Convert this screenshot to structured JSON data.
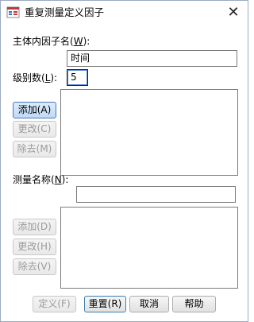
{
  "window": {
    "title": "重复测量定义因子",
    "close_glyph": "✕"
  },
  "factor": {
    "name_label_pre": "主体内因子名(",
    "name_label_key": "W",
    "name_label_post": "):",
    "name_value": "时间",
    "levels_label_pre": "级别数(",
    "levels_label_key": "L",
    "levels_label_post": "):",
    "levels_value": "5",
    "add_label": "添加(A)",
    "change_label": "更改(C)",
    "remove_label": "除去(M)"
  },
  "measure": {
    "name_label_pre": "测量名称(",
    "name_label_key": "N",
    "name_label_post": "):",
    "name_value": "",
    "add_label": "添加(D)",
    "change_label": "更改(H)",
    "remove_label": "除去(V)"
  },
  "footer": {
    "define_label": "定义(F)",
    "reset_label": "重置(R)",
    "cancel_label": "取消",
    "help_label": "帮助"
  },
  "colors": {
    "accent_border": "#4a77b6",
    "active_button_fill": "#c1daf6",
    "disabled_text": "#9a9a9a"
  },
  "icons": {
    "app": "spss-dialog-icon",
    "close": "close-icon"
  }
}
